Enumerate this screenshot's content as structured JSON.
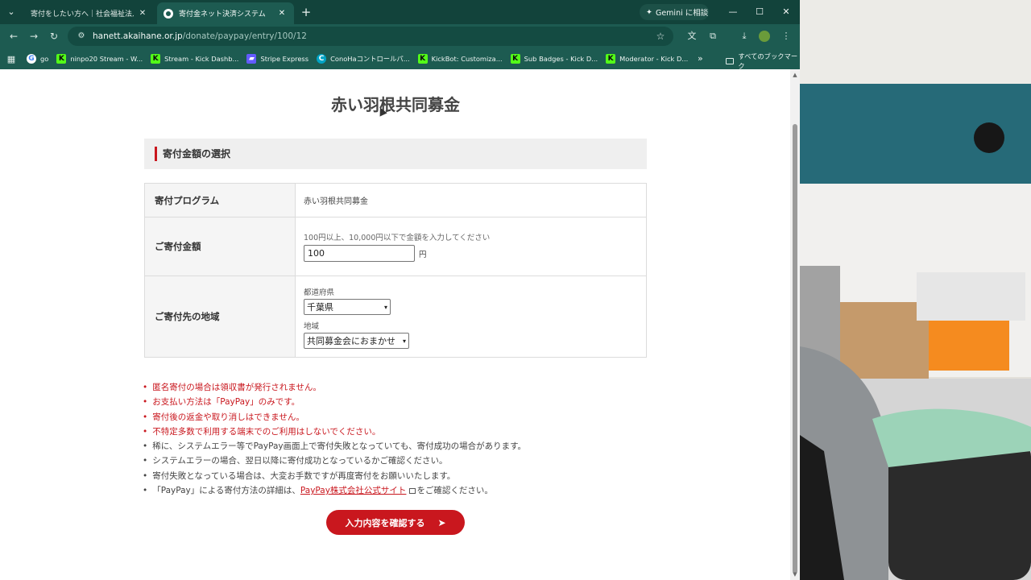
{
  "browser": {
    "tabs": [
      {
        "label": "寄付をしたい方へ｜社会福祉法人",
        "active": false
      },
      {
        "label": "寄付金ネット決済システム",
        "active": true
      }
    ],
    "gemini_label": "Gemini に相談",
    "url_host": "hanett.akaihane.or.jp",
    "url_path": "/donate/paypay/entry/100/12",
    "bookmarks": [
      {
        "label": "go",
        "icon": "g"
      },
      {
        "label": "ninpo20 Stream - W...",
        "icon": "k"
      },
      {
        "label": "Stream - Kick Dashb...",
        "icon": "k"
      },
      {
        "label": "Stripe Express",
        "icon": "s"
      },
      {
        "label": "ConoHaコントロールパ...",
        "icon": "c"
      },
      {
        "label": "KickBot: Customiza...",
        "icon": "k"
      },
      {
        "label": "Sub Badges - Kick D...",
        "icon": "k"
      },
      {
        "label": "Moderator - Kick D...",
        "icon": "k"
      }
    ],
    "all_bookmarks_label": "すべてのブックマーク"
  },
  "page": {
    "title": "赤い羽根共同募金",
    "section_title": "寄付金額の選択",
    "rows": {
      "program_label": "寄付プログラム",
      "program_value": "赤い羽根共同募金",
      "amount_label": "ご寄付金額",
      "amount_hint": "100円以上、10,000円以下で金額を入力してください",
      "amount_value": "100",
      "amount_unit": "円",
      "region_label": "ご寄付先の地域",
      "prefecture_label": "都道府県",
      "prefecture_selected": "千葉県",
      "area_label": "地域",
      "area_selected": "共同募金会におまかせ"
    },
    "notes": [
      {
        "text": "匿名寄付の場合は領収書が発行されません。",
        "red": true
      },
      {
        "text": "お支払い方法は「PayPay」のみです。",
        "red": true
      },
      {
        "text": "寄付後の返金や取り消しはできません。",
        "red": true
      },
      {
        "text": "不特定多数で利用する端末でのご利用はしないでください。",
        "red": true
      },
      {
        "text": "稀に、システムエラー等でPayPay画面上で寄付失敗となっていても、寄付成功の場合があります。",
        "red": false
      },
      {
        "text": "システムエラーの場合、翌日以降に寄付成功となっているかご確認ください。",
        "red": false
      },
      {
        "text": "寄付失敗となっている場合は、大変お手数ですが再度寄付をお願いいたします。",
        "red": false
      }
    ],
    "last_note_prefix": "「PayPay」による寄付方法の詳細は、",
    "last_note_link": "PayPay株式会社公式サイト",
    "last_note_suffix": "をご確認ください。",
    "submit_label": "入力内容を確認する",
    "accent_color": "#c9171e"
  }
}
